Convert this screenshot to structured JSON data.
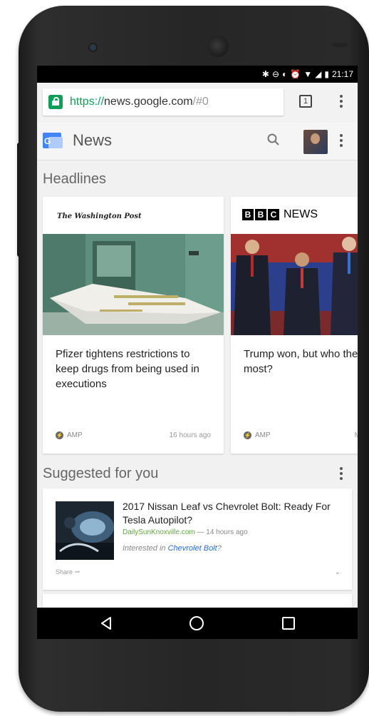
{
  "status": {
    "time": "21:17"
  },
  "browser": {
    "url_scheme": "https://",
    "url_host": "news.google.com",
    "url_hash": "/#0",
    "tab_count": "1"
  },
  "app": {
    "title": "News"
  },
  "headlines": {
    "title": "Headlines",
    "cards": [
      {
        "source": "The Washington Post",
        "title": "Pfizer tightens restrictions to keep drugs from being used in executions",
        "badge": "AMP",
        "time": "16 hours ago"
      },
      {
        "source_blocks": [
          "B",
          "B",
          "C"
        ],
        "source_word": "NEWS",
        "title": "Trump won, but who the most?",
        "badge": "AMP",
        "time": "M"
      }
    ]
  },
  "suggested": {
    "title": "Suggested for you",
    "item": {
      "title": "2017 Nissan Leaf vs Chevrolet Bolt: Ready For Tesla Autopilot?",
      "source": "DailySunKnoxville.com",
      "separator": " — ",
      "time": "14 hours ago",
      "interest_prefix": "Interested in ",
      "interest_topic": "Chevrolet Bolt",
      "interest_suffix": "?",
      "share": "Share ⇀"
    }
  },
  "colors": {
    "brand_green": "#0f9d58",
    "news_blue": "#4285f4",
    "link_blue": "#2a6ed1"
  }
}
